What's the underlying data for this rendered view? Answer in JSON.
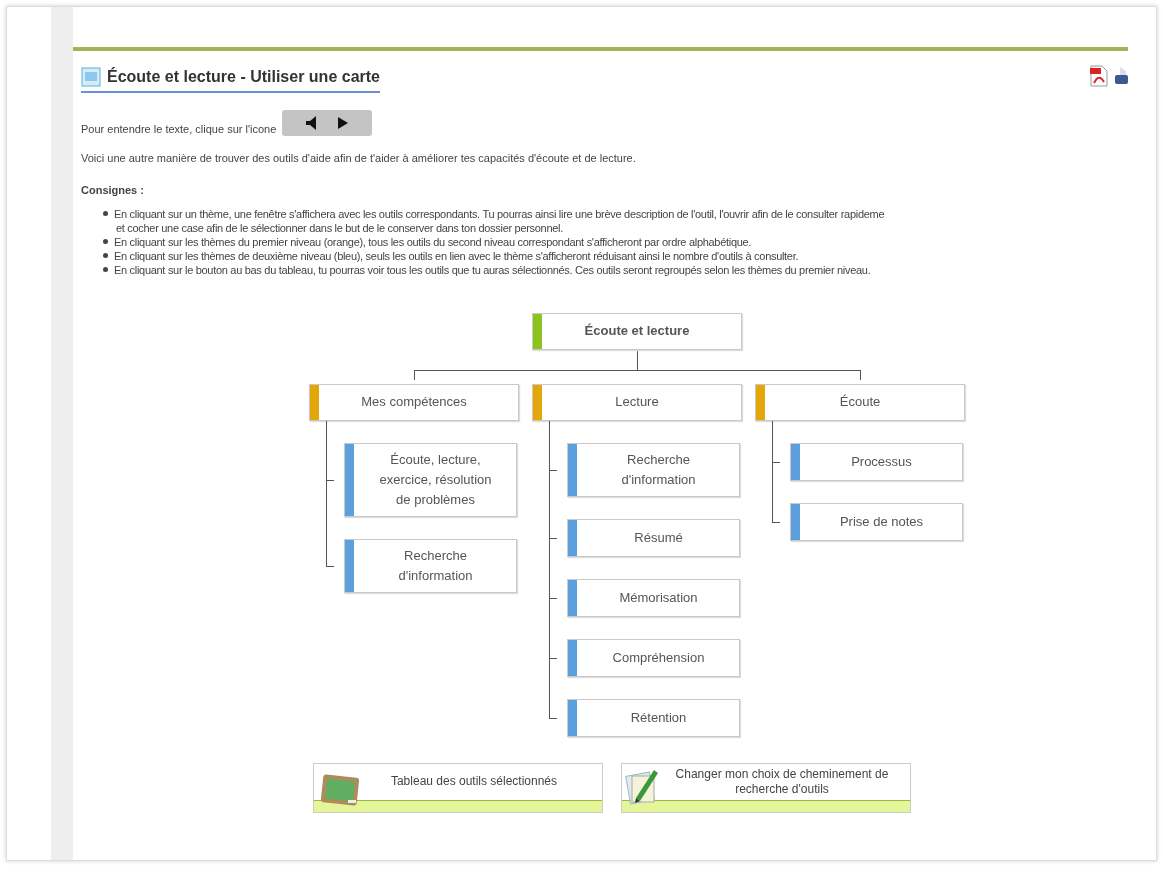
{
  "header": {
    "title": "Écoute et lecture - Utiliser une carte"
  },
  "audio": {
    "label": "Pour entendre le texte, clique sur l'icone"
  },
  "intro": "Voici une autre manière de trouver des outils d'aide afin de t'aider à améliorer tes capacités d'écoute et de lecture.",
  "instructions": {
    "heading": "Consignes :",
    "items": [
      "En cliquant sur un thème, une fenêtre s'affichera avec les outils correspondants. Tu pourras ainsi lire une brève description de l'outil, l'ouvrir afin de le consulter rapideme",
      "et cocher une case afin de le sélectionner dans le but de le conserver dans ton dossier personnel.",
      "En cliquant sur les thèmes du premier niveau (orange), tous les outils du second niveau correspondant s'afficheront par ordre alphabétique.",
      "En cliquant sur les thèmes de deuxième niveau (bleu), seuls les outils en lien avec le thème s'afficheront réduisant ainsi le nombre d'outils à consulter.",
      "En cliquant sur le bouton au bas du tableau, tu pourras voir tous les outils que tu auras sélectionnés. Ces outils seront regroupés selon les thèmes du premier niveau."
    ]
  },
  "tree": {
    "label": "Écoute et lecture",
    "children": [
      {
        "label": "Mes compétences",
        "children": [
          {
            "label": "Écoute, lecture, exercice, résolution de problèmes"
          },
          {
            "label": "Recherche d'information"
          }
        ]
      },
      {
        "label": "Lecture",
        "children": [
          {
            "label": "Recherche d'information"
          },
          {
            "label": "Résumé"
          },
          {
            "label": "Mémorisation"
          },
          {
            "label": "Compréhension"
          },
          {
            "label": "Rétention"
          }
        ]
      },
      {
        "label": "Écoute",
        "children": [
          {
            "label": "Processus"
          },
          {
            "label": "Prise de notes"
          }
        ]
      }
    ]
  },
  "buttons": [
    {
      "kind": "board",
      "label": "Tableau des outils sélectionnés"
    },
    {
      "kind": "pencil",
      "label": "Changer mon choix de cheminement de recherche d'outils"
    }
  ]
}
